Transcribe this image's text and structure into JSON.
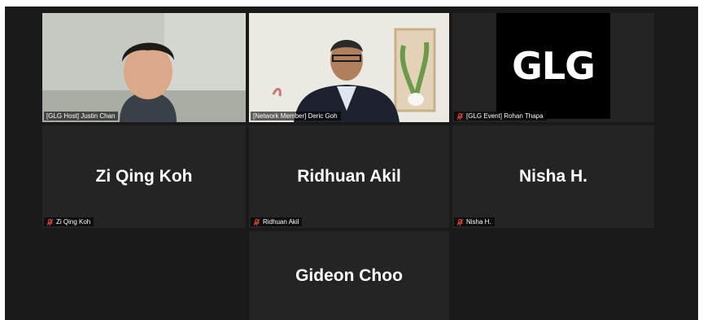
{
  "participants": [
    {
      "label": "[GLG Host] Justin Chan",
      "type": "video"
    },
    {
      "label": "[Network Member] Deric Goh",
      "type": "video"
    },
    {
      "label": "[GLG Event] Rohan Thapa",
      "type": "logo",
      "logo_text": "GLG"
    },
    {
      "display_name": "Zi Qing Koh",
      "label": "Zi Qing Koh",
      "type": "name"
    },
    {
      "display_name": "Ridhuan Akil",
      "label": "Ridhuan Akil",
      "type": "name"
    },
    {
      "display_name": "Nisha H.",
      "label": "Nisha H.",
      "type": "name"
    },
    {
      "display_name": "Gideon Choo",
      "label": "",
      "type": "name"
    }
  ],
  "colors": {
    "active_speaker_border": "#c8d94a",
    "muted_mic": "#e2483b",
    "tile_bg": "#242424"
  }
}
